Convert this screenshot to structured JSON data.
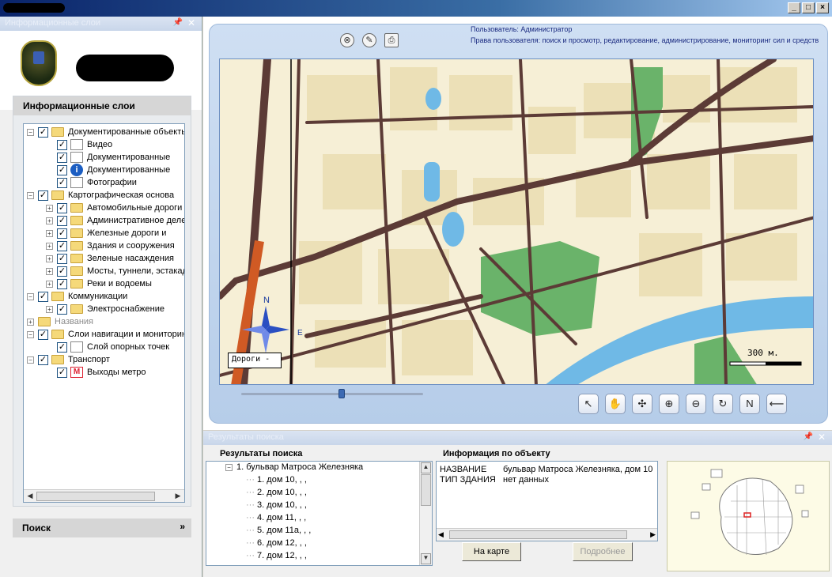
{
  "window": {
    "title": "",
    "buttons": [
      "_",
      "□",
      "×"
    ]
  },
  "left_panel": {
    "header": "Информационные слои",
    "layers_title": "Информационные слои",
    "search_label": "Поиск",
    "tree": [
      {
        "label": "Документированные объекты",
        "level": 0,
        "expander": "−",
        "checked": true,
        "icon": "folder"
      },
      {
        "label": "Видео",
        "level": 1,
        "checked": true,
        "icon": "doc"
      },
      {
        "label": "Документированные",
        "level": 1,
        "checked": true,
        "icon": "doc"
      },
      {
        "label": "Документированные",
        "level": 1,
        "checked": true,
        "icon": "info"
      },
      {
        "label": "Фотографии",
        "level": 1,
        "checked": true,
        "icon": "doc"
      },
      {
        "label": "Картографическая основа",
        "level": 0,
        "expander": "−",
        "checked": true,
        "icon": "folder"
      },
      {
        "label": "Автомобильные дороги",
        "level": 1,
        "expander": "+",
        "checked": true,
        "icon": "folder"
      },
      {
        "label": "Административное деление",
        "level": 1,
        "expander": "+",
        "checked": true,
        "icon": "folder"
      },
      {
        "label": "Железные дороги и",
        "level": 1,
        "expander": "+",
        "checked": true,
        "icon": "folder"
      },
      {
        "label": "Здания и сооружения",
        "level": 1,
        "expander": "+",
        "checked": true,
        "icon": "folder"
      },
      {
        "label": "Зеленые насаждения",
        "level": 1,
        "expander": "+",
        "checked": true,
        "icon": "folder"
      },
      {
        "label": "Мосты, туннели, эстакады",
        "level": 1,
        "expander": "+",
        "checked": true,
        "icon": "folder"
      },
      {
        "label": "Реки и водоемы",
        "level": 1,
        "expander": "+",
        "checked": true,
        "icon": "folder"
      },
      {
        "label": "Коммуникации",
        "level": 0,
        "expander": "−",
        "checked": true,
        "icon": "folder"
      },
      {
        "label": "Электроснабжение",
        "level": 1,
        "expander": "+",
        "checked": true,
        "icon": "folder"
      },
      {
        "label": "Названия",
        "level": 0,
        "expander": "+",
        "checked": null,
        "icon": "folder",
        "disabled": true
      },
      {
        "label": "Слои навигации и мониторинга",
        "level": 0,
        "expander": "−",
        "checked": true,
        "icon": "folder"
      },
      {
        "label": "Слой опорных точек",
        "level": 1,
        "checked": true,
        "icon": "doc"
      },
      {
        "label": "Транспорт",
        "level": 0,
        "expander": "−",
        "checked": true,
        "icon": "folder"
      },
      {
        "label": "Выходы метро",
        "level": 1,
        "checked": true,
        "icon": "metro"
      }
    ]
  },
  "map_panel": {
    "user_line": "Пользователь: Администратор",
    "rights_line": "Права пользователя: поиск и просмотр, редактирование, администрирование, мониторинг сил и средств",
    "top_icons": [
      "close-icon",
      "pencil-icon",
      "printer-icon"
    ],
    "scale_text": "300 м.",
    "layer_text": "Дороги -",
    "compass_n": "N",
    "compass_e": "E",
    "zoom_slider_value": 0.55,
    "tools": [
      {
        "name": "pointer-tool",
        "glyph": "↖"
      },
      {
        "name": "hand-tool",
        "glyph": "✋"
      },
      {
        "name": "center-tool",
        "glyph": "✣"
      },
      {
        "name": "zoom-in-tool",
        "glyph": "⊕"
      },
      {
        "name": "zoom-out-tool",
        "glyph": "⊖"
      },
      {
        "name": "refresh-tool",
        "glyph": "↻"
      },
      {
        "name": "north-tool",
        "glyph": "N"
      },
      {
        "name": "measure-tool",
        "glyph": "⟵"
      }
    ]
  },
  "results_panel": {
    "header": "Результаты поиска",
    "results_title": "Результаты поиска",
    "info_title": "Информация по объекту",
    "results": [
      {
        "label": "1. бульвар Матроса Железняка",
        "level": 0
      },
      {
        "label": "1.  дом 10, , ,",
        "level": 1
      },
      {
        "label": "2.  дом 10, , ,",
        "level": 1
      },
      {
        "label": "3.  дом 10, , ,",
        "level": 1
      },
      {
        "label": "4.  дом 11, , ,",
        "level": 1
      },
      {
        "label": "5.  дом 11а, , ,",
        "level": 1
      },
      {
        "label": "6.  дом 12, , ,",
        "level": 1
      },
      {
        "label": "7.  дом 12, , ,",
        "level": 1
      }
    ],
    "info": [
      {
        "key": "НАЗВАНИЕ",
        "value": "бульвар Матроса Железняка,  дом 10"
      },
      {
        "key": "ТИП ЗДАНИЯ",
        "value": "нет данных"
      }
    ],
    "on_map_button": "На карте",
    "details_button": "Подробнее"
  }
}
